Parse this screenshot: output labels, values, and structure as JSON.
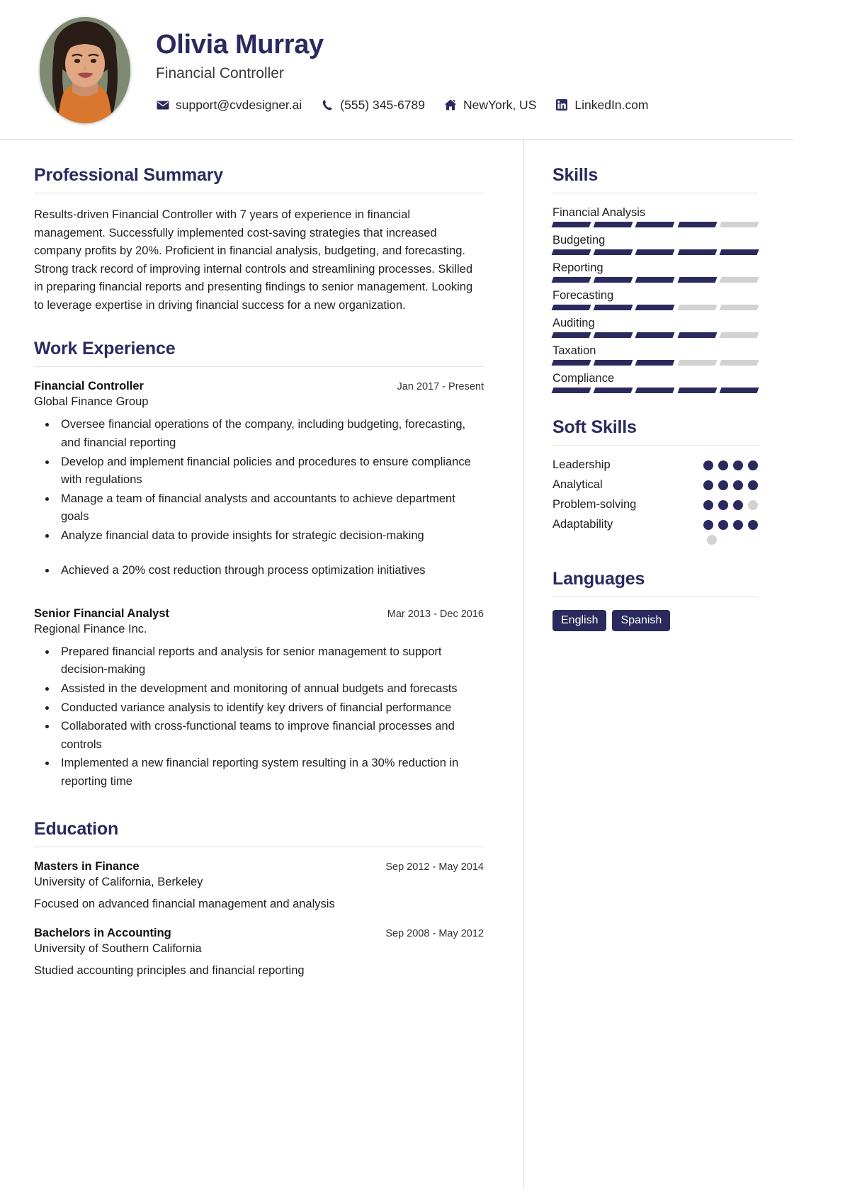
{
  "theme": {
    "accent": "#2b2a5e",
    "bar_empty": "#d2d2d2",
    "rule": "#e2e2e2"
  },
  "header": {
    "name": "Olivia Murray",
    "title": "Financial Controller",
    "avatar_alt": "profile-photo",
    "contacts": [
      {
        "icon": "email-icon",
        "text": "support@cvdesigner.ai"
      },
      {
        "icon": "phone-icon",
        "text": "(555) 345-6789"
      },
      {
        "icon": "home-icon",
        "text": "NewYork, US"
      },
      {
        "icon": "linkedin-icon",
        "text": "LinkedIn.com"
      }
    ]
  },
  "summary": {
    "heading": "Professional Summary",
    "text": "Results-driven Financial Controller with 7 years of experience in financial management. Successfully implemented cost-saving strategies that increased company profits by 20%. Proficient in financial analysis, budgeting, and forecasting. Strong track record of improving internal controls and streamlining processes. Skilled in preparing financial reports and presenting findings to senior management. Looking to leverage expertise in driving financial success for a new organization."
  },
  "experience": {
    "heading": "Work Experience",
    "entries": [
      {
        "role": "Financial Controller",
        "org": "Global Finance Group",
        "date": "Jan 2017 - Present",
        "bullets": [
          "Oversee financial operations of the company, including budgeting, forecasting, and financial reporting",
          "Develop and implement financial policies and procedures to ensure compliance with regulations",
          "Manage a team of financial analysts and accountants to achieve department goals",
          "Analyze financial data to provide insights for strategic decision-making"
        ],
        "achievements": [
          "Achieved a 20% cost reduction through process optimization initiatives"
        ]
      },
      {
        "role": "Senior Financial Analyst",
        "org": "Regional Finance Inc.",
        "date": "Mar 2013 - Dec 2016",
        "bullets": [
          "Prepared financial reports and analysis for senior management to support decision-making",
          "Assisted in the development and monitoring of annual budgets and forecasts",
          "Conducted variance analysis to identify key drivers of financial performance",
          "Collaborated with cross-functional teams to improve financial processes and controls",
          "Implemented a new financial reporting system resulting in a 30% reduction in reporting time"
        ],
        "achievements": []
      }
    ]
  },
  "education": {
    "heading": "Education",
    "entries": [
      {
        "degree": "Masters in Finance",
        "school": "University of California, Berkeley",
        "date": "Sep 2012 - May 2014",
        "desc": "Focused on advanced financial management and analysis"
      },
      {
        "degree": "Bachelors in Accounting",
        "school": "University of Southern California",
        "date": "Sep 2008 - May 2012",
        "desc": "Studied accounting principles and financial reporting"
      }
    ]
  },
  "skills": {
    "heading": "Skills",
    "segments_total": 5,
    "items": [
      {
        "name": "Financial Analysis",
        "level": 4
      },
      {
        "name": "Budgeting",
        "level": 5
      },
      {
        "name": "Reporting",
        "level": 4
      },
      {
        "name": "Forecasting",
        "level": 3
      },
      {
        "name": "Auditing",
        "level": 4
      },
      {
        "name": "Taxation",
        "level": 3
      },
      {
        "name": "Compliance",
        "level": 5
      }
    ]
  },
  "soft_skills": {
    "heading": "Soft Skills",
    "dots_total": 4,
    "items": [
      {
        "name": "Leadership",
        "level": 4
      },
      {
        "name": "Analytical",
        "level": 4
      },
      {
        "name": "Problem-solving",
        "level": 3
      },
      {
        "name": "Adaptability",
        "level": 4
      }
    ],
    "trailing_dot": true
  },
  "languages": {
    "heading": "Languages",
    "items": [
      "English",
      "Spanish"
    ]
  }
}
